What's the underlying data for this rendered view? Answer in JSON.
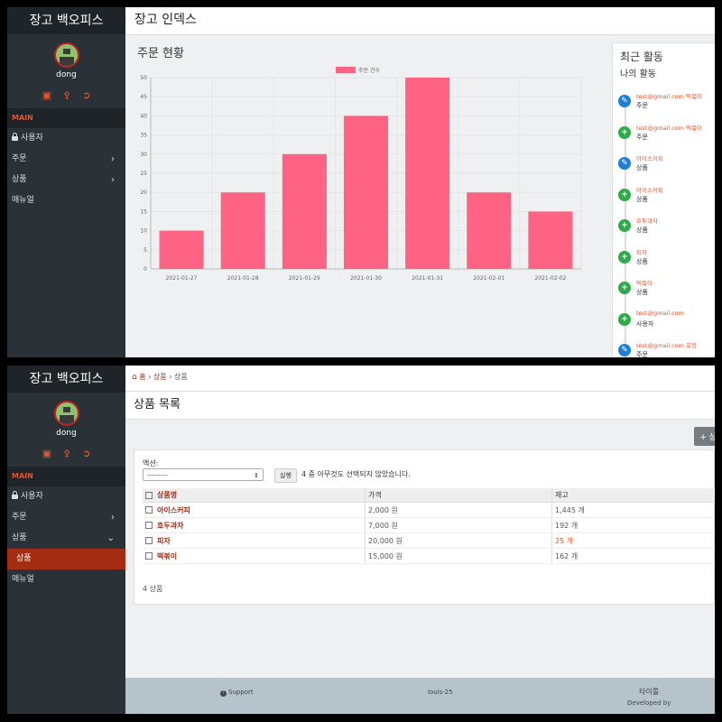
{
  "sidebar": {
    "brand": "장고 백오피스",
    "username": "dong",
    "section": "MAIN",
    "items": {
      "users": "사용자",
      "orders": "주문",
      "products": "상품",
      "products_sub": "상품",
      "manual": "매뉴얼"
    }
  },
  "screen1": {
    "title": "장고 인덱스",
    "chart_title": "주문 현황",
    "activity": {
      "title": "최근 활동",
      "subtitle": "나의 활동",
      "items": [
        {
          "type": "edit",
          "text": "test@gmail.com 떡볶이",
          "sub": "주문"
        },
        {
          "type": "add",
          "text": "test@gmail.com 떡볶이",
          "sub": "주문"
        },
        {
          "type": "edit",
          "text": "아이스커피",
          "sub": "상품"
        },
        {
          "type": "add",
          "text": "아이스커피",
          "sub": "상품"
        },
        {
          "type": "add",
          "text": "호두과자",
          "sub": "상품"
        },
        {
          "type": "add",
          "text": "피자",
          "sub": "상품"
        },
        {
          "type": "add",
          "text": "떡볶이",
          "sub": "상품"
        },
        {
          "type": "add",
          "text": "test@gmail.com",
          "sub": "사용자"
        },
        {
          "type": "edit",
          "text": "test@gmail.com 포장",
          "sub": "주문"
        }
      ]
    }
  },
  "chart_data": {
    "type": "bar",
    "categories": [
      "2021-01-27",
      "2021-01-28",
      "2021-01-29",
      "2021-01-30",
      "2021-01-31",
      "2021-02-01",
      "2021-02-02"
    ],
    "series": [
      {
        "name": "주문 건수",
        "values": [
          10,
          20,
          30,
          40,
          50,
          20,
          15
        ],
        "color": "#ff6384"
      }
    ],
    "yticks": [
      "0",
      "5",
      "10",
      "15",
      "20",
      "25",
      "30",
      "35",
      "40",
      "45",
      "50"
    ],
    "ylim": [
      0,
      50
    ],
    "grid": true,
    "legend": "top"
  },
  "screen2": {
    "breadcrumb": {
      "home": "홈",
      "parent": "상품",
      "current": "상품"
    },
    "title": "상품 목록",
    "add_button": "+ 상",
    "action_label": "액션:",
    "action_select": "---------",
    "go_button": "실행",
    "selection_msg": "4 중 아무것도 선택되지 않았습니다.",
    "columns": [
      "상품명",
      "가격",
      "재고"
    ],
    "rows": [
      {
        "name": "아이스커피",
        "price": "2,000 원",
        "stock": "1,445 개"
      },
      {
        "name": "호두과자",
        "price": "7,000 원",
        "stock": "192 개"
      },
      {
        "name": "피자",
        "price": "20,000 원",
        "stock": "25 개"
      },
      {
        "name": "떡볶이",
        "price": "15,000 원",
        "stock": "162 개"
      }
    ],
    "count": "4 상품",
    "footer": {
      "support": "Support",
      "middle": "louis-25",
      "right": "타이틀",
      "developed": "Developed by"
    }
  },
  "colors": {
    "accent": "#e8542a",
    "active_nav": "#a42d13",
    "sidebar": "#2a3238",
    "bar": "#ff6384"
  }
}
